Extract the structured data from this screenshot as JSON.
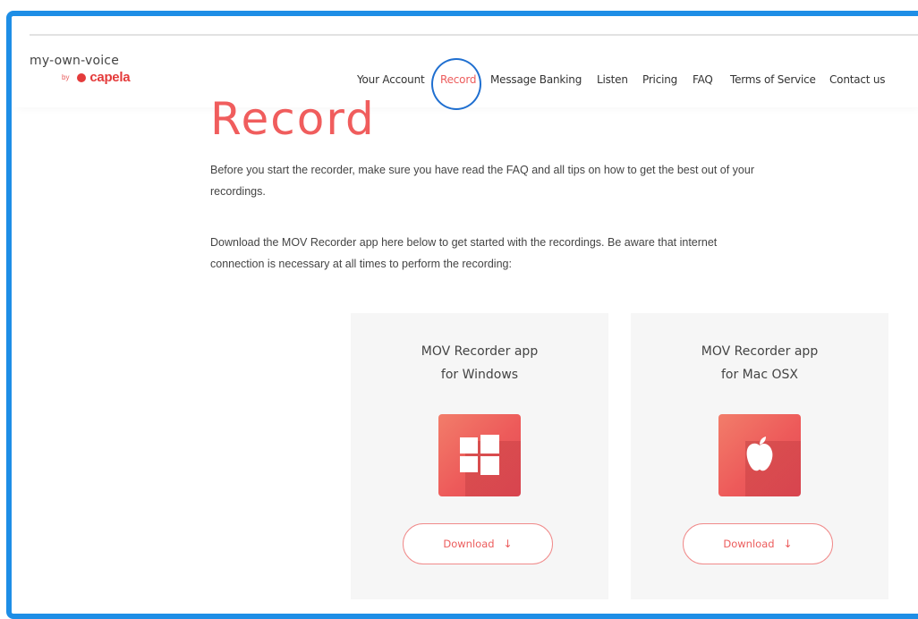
{
  "logo": {
    "name": "my-own-voice",
    "by": "by",
    "brand": "capela"
  },
  "nav": {
    "items": [
      {
        "label": "Your Account"
      },
      {
        "label": "Record"
      },
      {
        "label": "Message Banking"
      },
      {
        "label": "Listen"
      },
      {
        "label": "Pricing"
      },
      {
        "label": "FAQ"
      },
      {
        "label": "Terms of Service"
      },
      {
        "label": "Contact us"
      }
    ],
    "active": "Record"
  },
  "page": {
    "title": "Record",
    "para1": "Before you start the recorder, make sure you have read the FAQ and all tips on how to get the best out of your recordings.",
    "para2": "Download the MOV Recorder app here below to get started with the recordings. Be aware that internet connection is necessary at all times to perform the recording:"
  },
  "cards": [
    {
      "title_line1": "MOV Recorder app",
      "title_line2": "for Windows",
      "icon": "windows-icon",
      "button": "Download",
      "button_icon": "download-arrow-icon"
    },
    {
      "title_line1": "MOV Recorder app",
      "title_line2": "for Mac OSX",
      "icon": "apple-icon",
      "button": "Download",
      "button_icon": "download-arrow-icon"
    }
  ],
  "colors": {
    "accent": "#f05d5d",
    "highlight_ring": "#1f6fd0",
    "frame": "#1e8ee6"
  }
}
